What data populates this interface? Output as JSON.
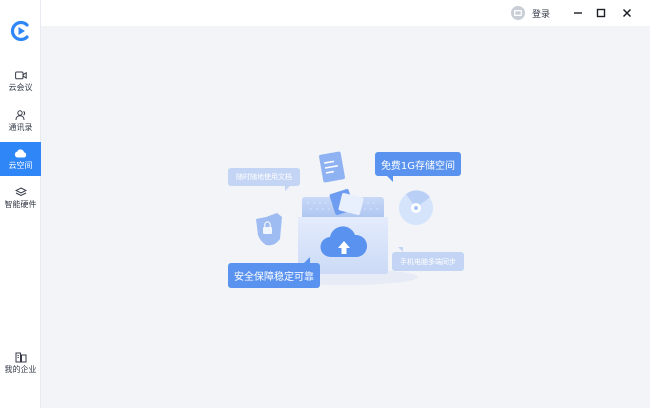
{
  "sidebar": {
    "logo": "app-logo",
    "items": [
      {
        "label": "云会议",
        "icon": "video-camera-icon",
        "active": false
      },
      {
        "label": "通讯录",
        "icon": "contacts-icon",
        "active": false
      },
      {
        "label": "云空间",
        "icon": "cloud-icon",
        "active": true
      },
      {
        "label": "智能硬件",
        "icon": "layers-icon",
        "active": false
      }
    ],
    "bottom_item": {
      "label": "我的企业",
      "icon": "building-icon"
    }
  },
  "titlebar": {
    "login_label": "登录",
    "controls": [
      "minimize-icon",
      "maximize-icon",
      "close-icon"
    ]
  },
  "illustration": {
    "tags": {
      "anywhere_docs": "随时随地使用文档",
      "free_storage": "免费1G存储空间",
      "secure": "安全保障稳定可靠",
      "multi_device_sync": "手机电脑多端同步"
    }
  },
  "colors": {
    "accent": "#2f86f6",
    "tag_strong": "#5a93ef",
    "tag_light": "#c3d4f4",
    "background": "#f2f4f8"
  }
}
